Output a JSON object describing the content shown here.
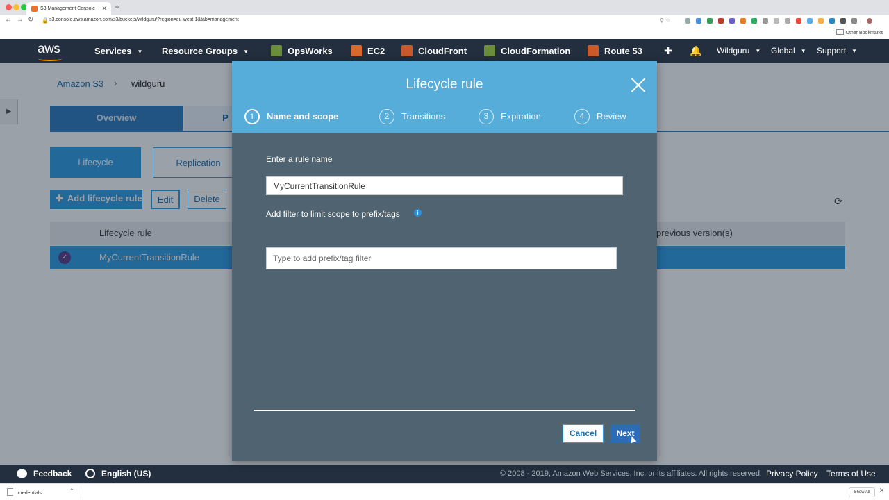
{
  "browser": {
    "tab_title": "S3 Management Console",
    "url": "s3.console.aws.amazon.com/s3/buckets/wildguru/?region=eu-west-1&tab=management",
    "bookmarks_label": "Other Bookmarks",
    "download_file": "credentials",
    "show_all": "Show All"
  },
  "nav": {
    "logo": "aws",
    "services": "Services",
    "resource_groups": "Resource Groups",
    "opsworks": "OpsWorks",
    "ec2": "EC2",
    "cloudfront": "CloudFront",
    "cloudformation": "CloudFormation",
    "route53": "Route 53",
    "account": "Wildguru",
    "region": "Global",
    "support": "Support",
    "icon_colors": {
      "opsworks": "#6b8e3a",
      "ec2": "#d86b2c",
      "cloudfront": "#c95a2a",
      "cloudformation": "#6b8e3a",
      "route53": "#c95a2a"
    }
  },
  "page": {
    "breadcrumb_root": "Amazon S3",
    "breadcrumb_current": "wildguru",
    "tabs": [
      "Overview",
      "P"
    ],
    "subtabs": [
      "Lifecycle",
      "Replication"
    ],
    "add_rule": "Add lifecycle rule",
    "edit": "Edit",
    "delete": "Delete",
    "col_rule": "Lifecycle rule",
    "col_prev": "previous version(s)",
    "row_rule": "MyCurrentTransitionRule"
  },
  "modal": {
    "title": "Lifecycle rule",
    "steps": [
      {
        "num": "1",
        "label": "Name and scope"
      },
      {
        "num": "2",
        "label": "Transitions"
      },
      {
        "num": "3",
        "label": "Expiration"
      },
      {
        "num": "4",
        "label": "Review"
      }
    ],
    "rule_name_label": "Enter a rule name",
    "rule_name_value": "MyCurrentTransitionRule",
    "filter_label": "Add filter to limit scope to prefix/tags",
    "filter_placeholder": "Type to add prefix/tag filter",
    "cancel": "Cancel",
    "next": "Next"
  },
  "footer": {
    "feedback": "Feedback",
    "language": "English (US)",
    "copyright": "© 2008 - 2019, Amazon Web Services, Inc. or its affiliates. All rights reserved.",
    "privacy": "Privacy Policy",
    "terms": "Terms of Use"
  }
}
